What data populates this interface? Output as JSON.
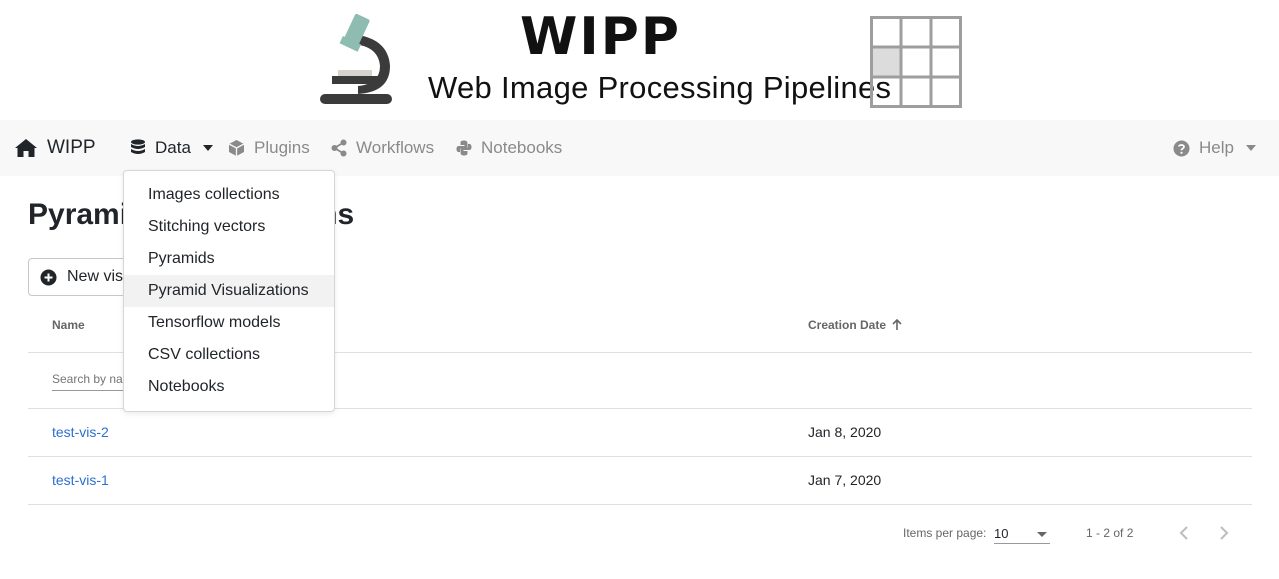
{
  "banner": {
    "logo_title": "WIPP",
    "logo_subtitle": "Web Image Processing Pipelines"
  },
  "navbar": {
    "brand": "WIPP",
    "data": "Data",
    "plugins": "Plugins",
    "workflows": "Workflows",
    "notebooks": "Notebooks",
    "help": "Help"
  },
  "data_menu": {
    "items": [
      {
        "label": "Images collections"
      },
      {
        "label": "Stitching vectors"
      },
      {
        "label": "Pyramids"
      },
      {
        "label": "Pyramid Visualizations"
      },
      {
        "label": "Tensorflow models"
      },
      {
        "label": "CSV collections"
      },
      {
        "label": "Notebooks"
      }
    ],
    "highlighted": "Pyramid Visualizations"
  },
  "page": {
    "title": "Pyramid Visualizations",
    "new_button": "New visualization"
  },
  "table": {
    "columns": {
      "name": "Name",
      "creation_date": "Creation Date"
    },
    "search_placeholder": "Search by name",
    "rows": [
      {
        "name": "test-vis-2",
        "date": "Jan 8, 2020"
      },
      {
        "name": "test-vis-1",
        "date": "Jan 7, 2020"
      }
    ],
    "sort": {
      "column": "Creation Date",
      "direction": "ascending"
    }
  },
  "paginator": {
    "items_per_page_label": "Items per page:",
    "items_per_page": "10",
    "range": "1 - 2 of 2"
  },
  "colors": {
    "link": "#2c6fd1",
    "navbar_bg": "#f8f8f8",
    "nav_muted": "#8a8a8a"
  }
}
